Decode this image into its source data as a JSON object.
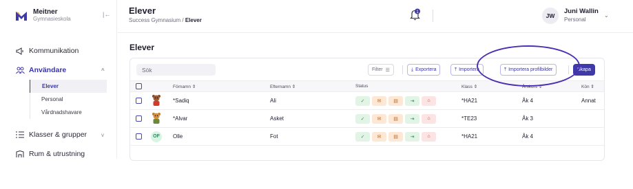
{
  "brand": {
    "name": "Meitner",
    "subtitle": "Gymnasieskola",
    "collapse_glyph": "|←"
  },
  "nav": {
    "communication": {
      "label": "Kommunikation",
      "icon": "megaphone-icon"
    },
    "users": {
      "label": "Användare",
      "icon": "users-icon",
      "chevron": "^"
    },
    "users_sub": [
      {
        "label": "Elever",
        "selected": true
      },
      {
        "label": "Personal"
      },
      {
        "label": "Vårdnadshavare"
      }
    ],
    "classes": {
      "label": "Klasser & grupper",
      "icon": "list-icon",
      "chevron": "v"
    },
    "rooms": {
      "label": "Rum & utrustning",
      "icon": "building-icon"
    }
  },
  "header": {
    "title": "Elever",
    "breadcrumb_root": "Success Gymnasium",
    "breadcrumb_sep": "/",
    "breadcrumb_current": "Elever",
    "notification_count": "1",
    "user_initials": "JW",
    "user_name": "Juni Wallin",
    "user_role": "Personal"
  },
  "main": {
    "section_title": "Elever",
    "search_placeholder": "Sök",
    "filter_label": "Filter",
    "export_label": "Exportera",
    "import_label": "Importera",
    "import_pictures_label": "Importera profilbilder",
    "create_label": "Skapa",
    "columns": [
      "Förnamn",
      "Efternamn",
      "Status",
      "Klass",
      "Årskurs",
      "Kön"
    ],
    "rows": [
      {
        "first": "*Sadiq",
        "last": "Ali",
        "klass": "*HA21",
        "arskurs": "Åk 4",
        "kon": "Annat",
        "avatar": "bear-red"
      },
      {
        "first": "*Alvar",
        "last": "Asket",
        "klass": "*TE23",
        "arskurs": "Åk 3",
        "kon": "",
        "avatar": "bear-orange"
      },
      {
        "first": "Olle",
        "last": "Fot",
        "klass": "*HA21",
        "arskurs": "Åk 4",
        "kon": "",
        "avatar": "initials",
        "initials": "OF"
      }
    ],
    "status_icons": [
      "check-icon",
      "mail-icon",
      "doc-icon",
      "logout-icon",
      "lock-icon"
    ]
  },
  "colors": {
    "accent": "#3f3aa8",
    "annotation": "#4b2fb3",
    "status_green": "#e2f4e6",
    "status_orange": "#fde8d6",
    "status_red": "#fde4e4"
  }
}
